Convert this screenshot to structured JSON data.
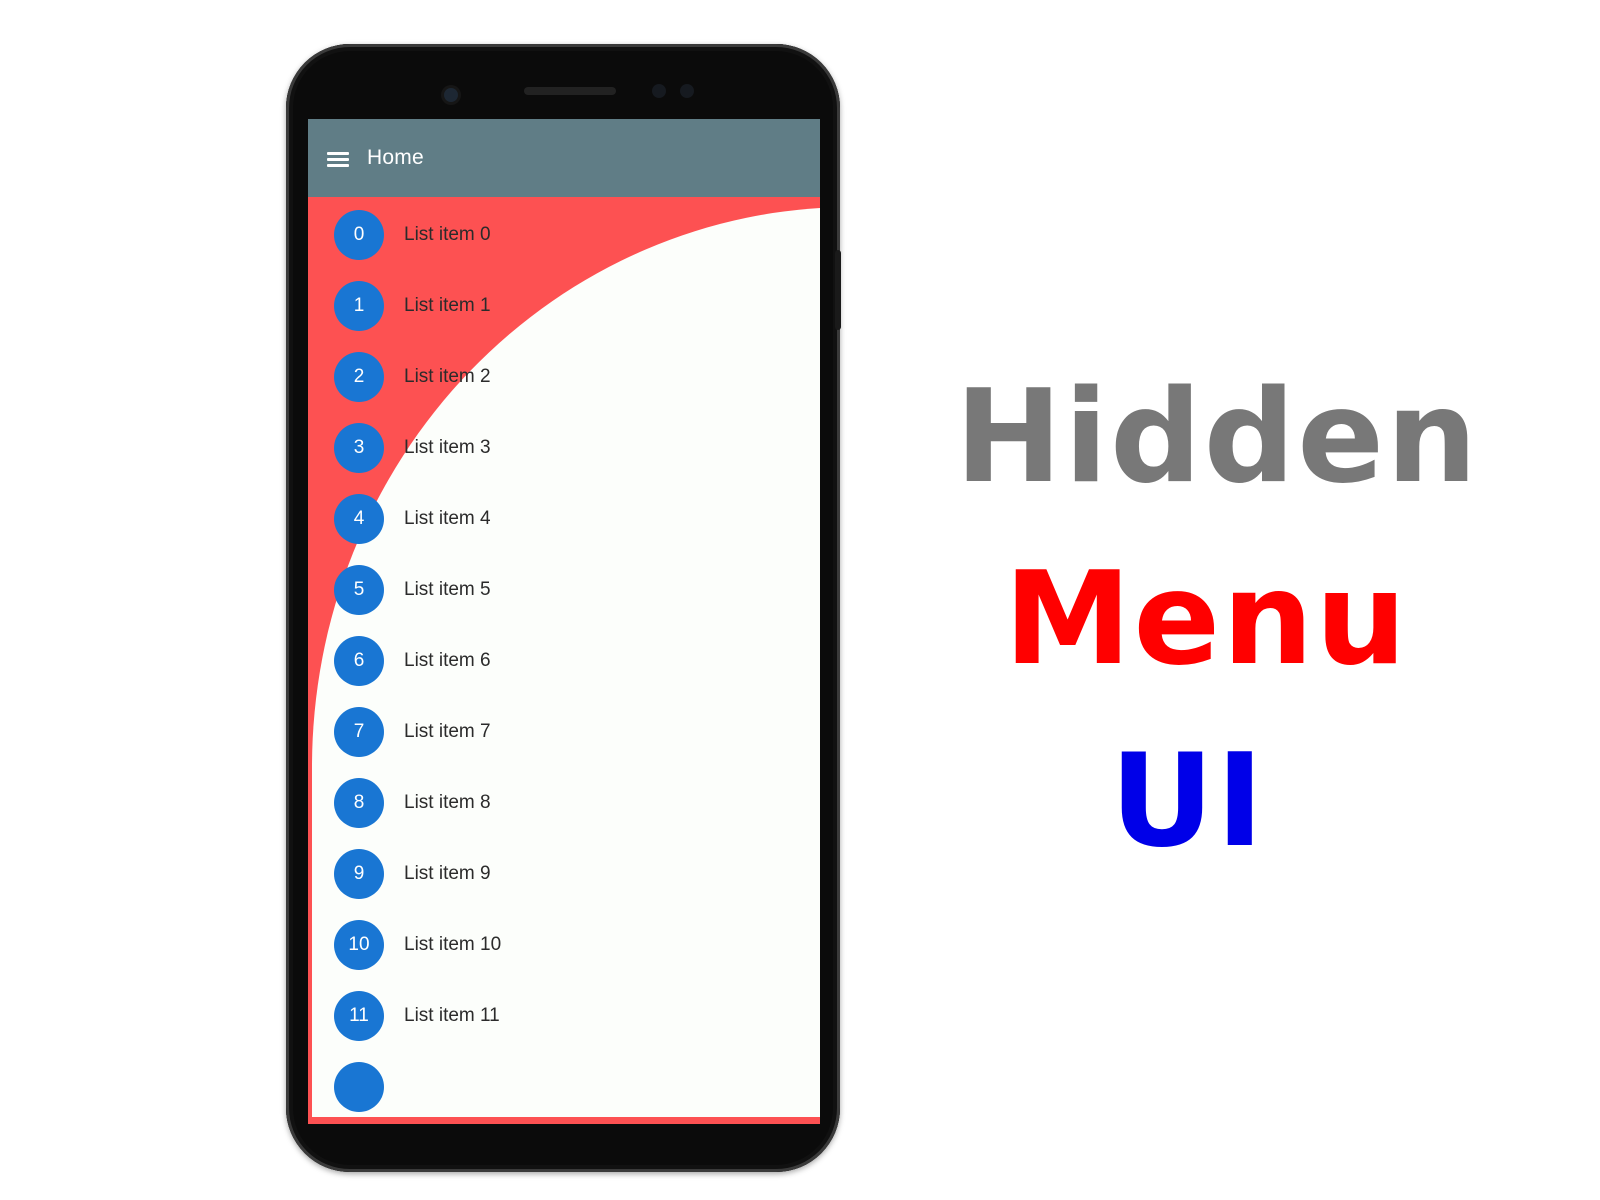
{
  "appbar": {
    "title": "Home",
    "menu_icon": "hamburger-menu-icon",
    "color": "#607d86"
  },
  "list": {
    "items": [
      {
        "badge": "0",
        "label": "List item 0"
      },
      {
        "badge": "1",
        "label": "List item 1"
      },
      {
        "badge": "2",
        "label": "List item 2"
      },
      {
        "badge": "3",
        "label": "List item 3"
      },
      {
        "badge": "4",
        "label": "List item 4"
      },
      {
        "badge": "5",
        "label": "List item 5"
      },
      {
        "badge": "6",
        "label": "List item 6"
      },
      {
        "badge": "7",
        "label": "List item 7"
      },
      {
        "badge": "8",
        "label": "List item 8"
      },
      {
        "badge": "9",
        "label": "List item 9"
      },
      {
        "badge": "10",
        "label": "List item 10"
      },
      {
        "badge": "11",
        "label": "List item 11"
      },
      {
        "badge": "",
        "label": ""
      }
    ],
    "avatar_color": "#1976d3",
    "background_color": "#fd5152"
  },
  "headline": {
    "line1": "Hidden",
    "line2": "Menu",
    "line3": "UI",
    "line1_color": "#787878",
    "line2_color": "#ff0000",
    "line3_color": "#0000e8"
  }
}
